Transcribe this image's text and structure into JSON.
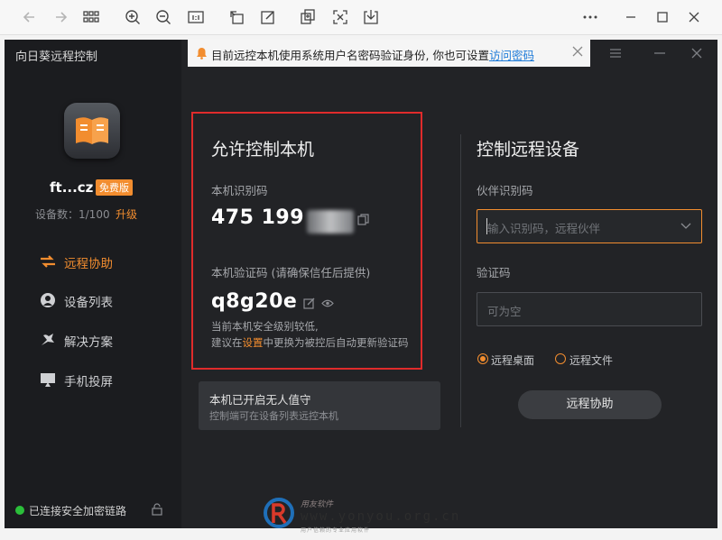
{
  "viewer_toolbar": {
    "icons": [
      "back-arrow-icon",
      "forward-arrow-icon",
      "grid-icon",
      "zoom-in-icon",
      "zoom-out-icon",
      "actual-size-icon",
      "rotate-icon",
      "edit-icon",
      "crop-icon",
      "fit-icon",
      "download-icon",
      "more-icon",
      "minimize-icon",
      "maximize-icon",
      "close-icon"
    ]
  },
  "app": {
    "title": "向日葵远程控制",
    "username": "ft...cz",
    "badge": "免费版",
    "device_count": "设备数：1/100",
    "upgrade": "升级",
    "nav": [
      {
        "label": "远程协助",
        "icon": "remote-assist-icon",
        "active": true
      },
      {
        "label": "设备列表",
        "icon": "device-list-icon",
        "active": false
      },
      {
        "label": "解决方案",
        "icon": "solution-icon",
        "active": false
      },
      {
        "label": "手机投屏",
        "icon": "screen-cast-icon",
        "active": false
      }
    ],
    "secure_status": "已连接安全加密链路"
  },
  "notice": {
    "message": "目前远控本机使用系统用户名密码验证身份, 你也可设置",
    "link": "访问密码"
  },
  "allow_panel": {
    "title": "允许控制本机",
    "id_label": "本机识别码",
    "id_value": "475 199",
    "code_label": "本机验证码 (请确保信任后提供)",
    "code_value": "q8g20e",
    "note_line1": "当前本机安全级别较低,",
    "note_prefix": "建议在",
    "note_link": "设置",
    "note_suffix": "中更换为被控后自动更新验证码"
  },
  "unattended": {
    "title": "本机已开启无人值守",
    "subtitle": "控制端可在设备列表远控本机"
  },
  "control_panel": {
    "title": "控制远程设备",
    "partner_label": "伙伴识别码",
    "partner_placeholder": "输入识别码，远程伙伴",
    "code_label": "验证码",
    "code_placeholder": "可为空",
    "radio_desktop": "远程桌面",
    "radio_file": "远程文件",
    "button": "远程协助"
  },
  "watermark": {
    "cn": "用友软件",
    "url": "www.yonyou.org.cn",
    "small": "用户信赖的专业应用软件"
  },
  "colors": {
    "accent": "#f28d2f",
    "highlight_border": "#e02b2b",
    "link": "#1e7bd8",
    "secure": "#2bbf3a"
  }
}
